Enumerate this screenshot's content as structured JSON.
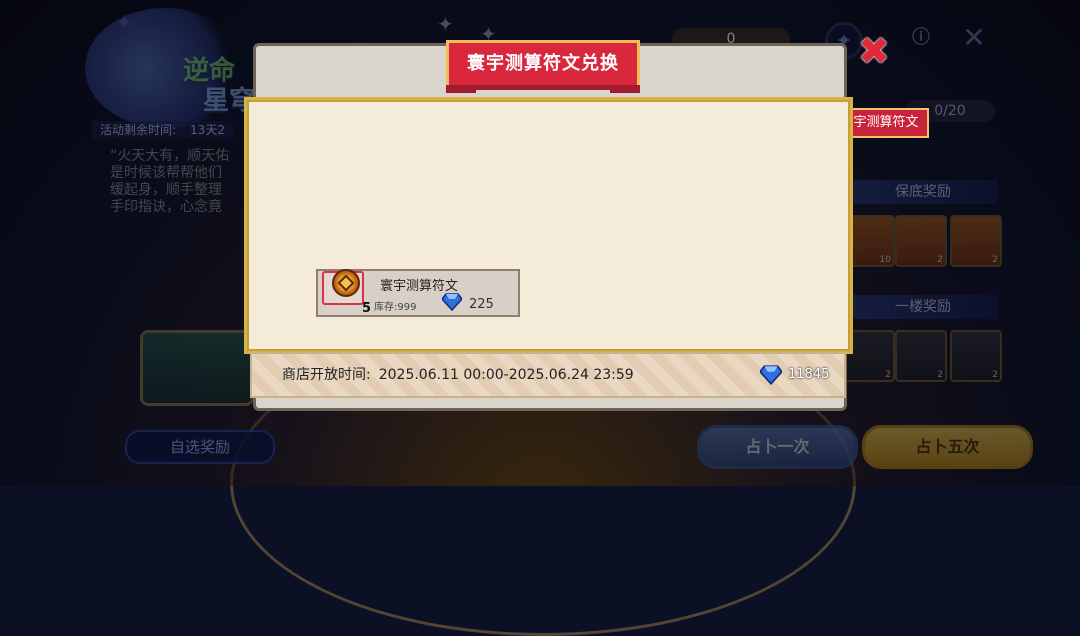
{
  "background": {
    "event_title_line1": "逆命",
    "event_title_line2": "星穹",
    "time_left_label": "活动剩余时间:",
    "time_left_value": "13天2",
    "story_text": "“火天大有，顺天佑\n是时候该帮帮他们\n缓起身，顺手整理\n手印指诀，心念竟",
    "tag_ribbon": "宇测算符文",
    "counter_right": "0/20",
    "top_counter": "0",
    "guarantee_title": "保底奖励",
    "floor_title": "一楼奖励",
    "guarantee_counts": [
      "10",
      "2",
      "2"
    ],
    "floor_counts": [
      "2",
      "2",
      "2"
    ],
    "btn_select": "自选奖励",
    "btn_once": "占卜一次",
    "btn_five": "占卜五次"
  },
  "modal": {
    "title": "寰宇测算符文兑换",
    "close_icon": "close-icon",
    "item": {
      "name": "寰宇测算符文",
      "quantity": "5",
      "stock": "库存:999",
      "price": "225",
      "currency_icon": "diamond-icon"
    },
    "footer": {
      "shop_time_label": "商店开放时间:",
      "shop_time_value": "2025.06.11 00:00-2025.06.24 23:59",
      "balance": "11845",
      "balance_icon": "diamond-icon"
    }
  },
  "colors": {
    "title_red": "#d9283e",
    "gold_border": "#d8b445",
    "content_bg": "#f4ecd8",
    "diamond_blue": "#2f6fe0"
  }
}
